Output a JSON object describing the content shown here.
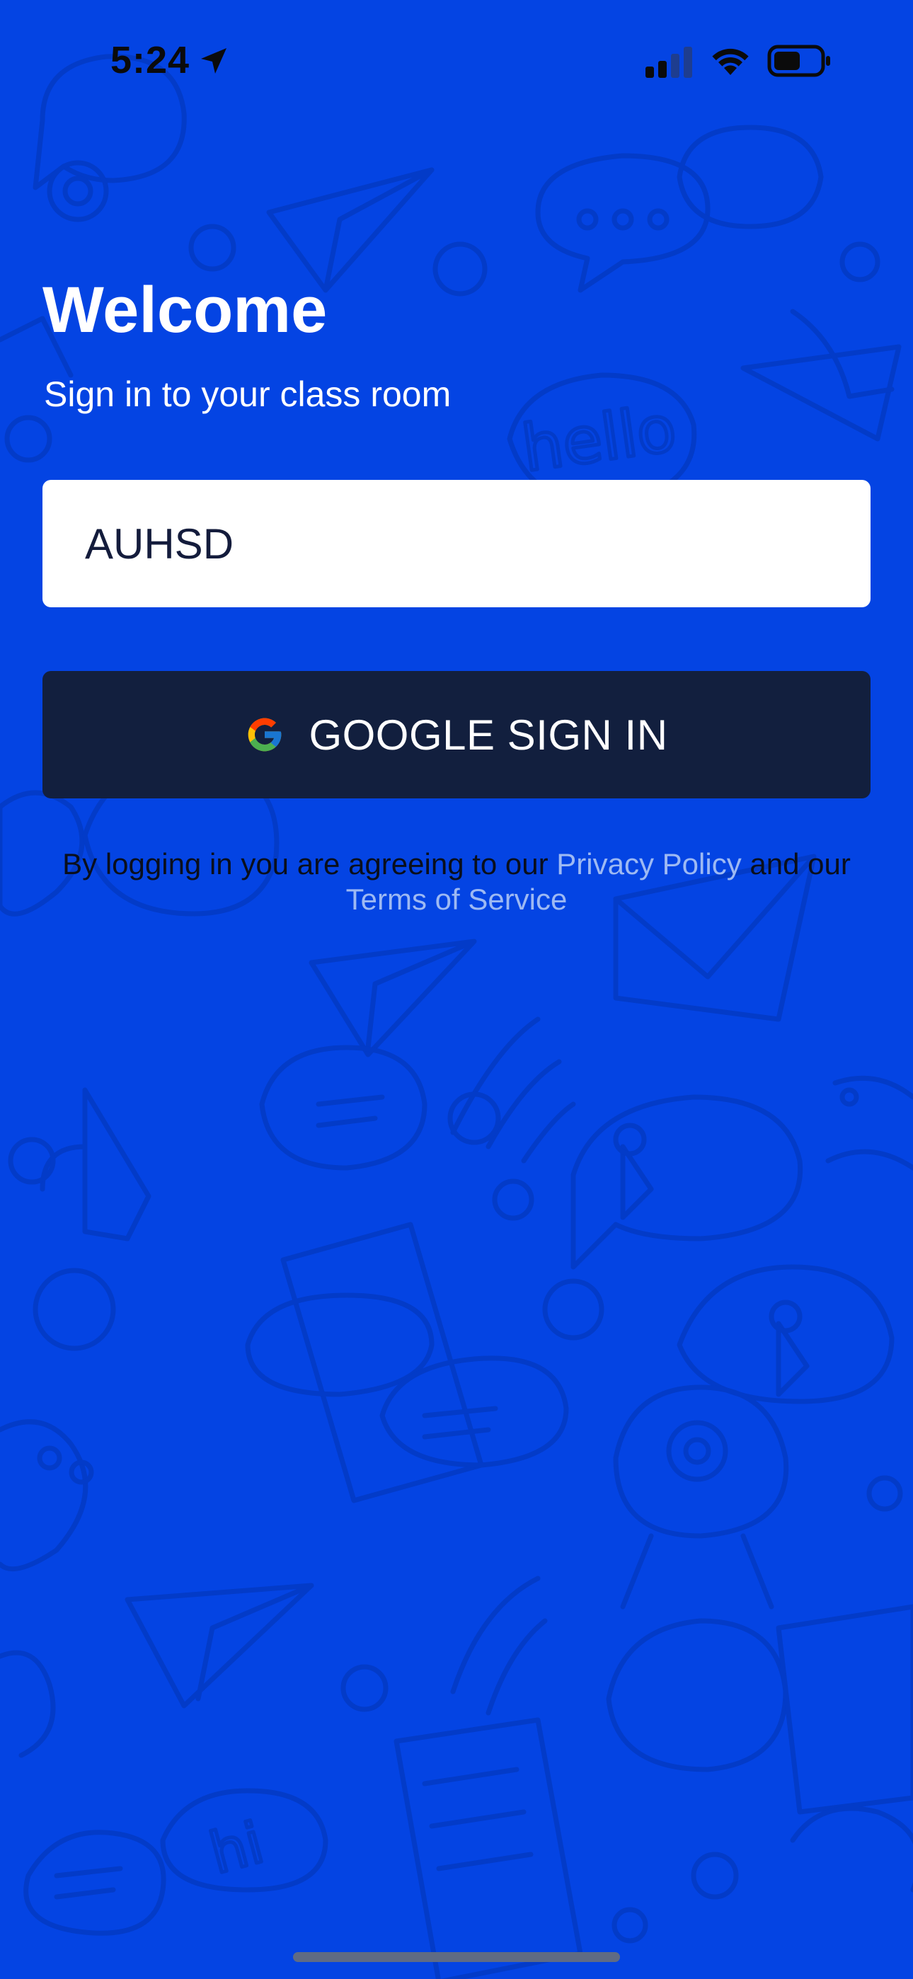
{
  "status_bar": {
    "time": "5:24",
    "icons": [
      "location-arrow-icon",
      "cellular-signal-icon",
      "wifi-icon",
      "battery-icon"
    ]
  },
  "welcome": {
    "title": "Welcome",
    "subtitle": "Sign in to your class room"
  },
  "district_input": {
    "value": "AUHSD"
  },
  "google_button": {
    "label": "GOOGLE SIGN IN",
    "icon": "google-g-icon"
  },
  "legal": {
    "prefix": "By logging in you are agreeing to our ",
    "privacy_link": "Privacy Policy",
    "middle": " and our ",
    "terms_link": "Terms of Service"
  },
  "colors": {
    "background": "#0444E3",
    "button": "#121F3E",
    "link": "#9DB9F3",
    "input": "#FFFFFF"
  }
}
